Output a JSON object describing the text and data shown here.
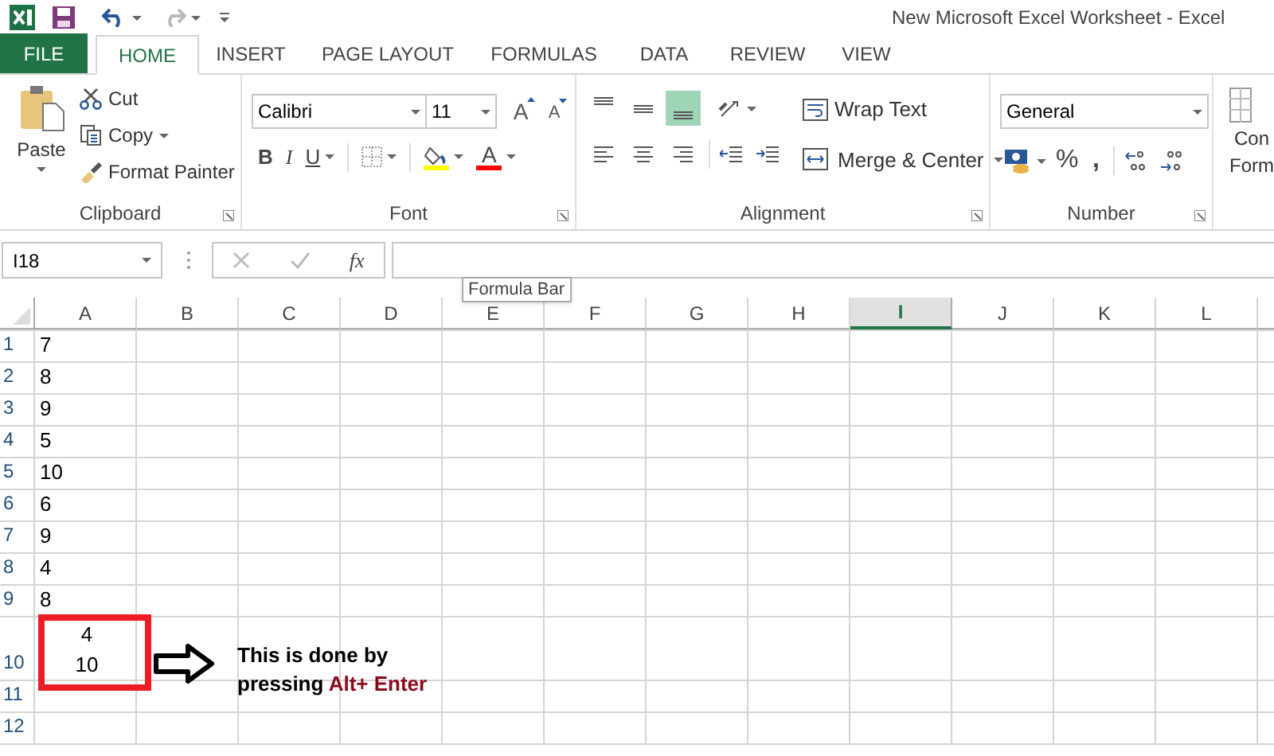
{
  "window": {
    "title": "New Microsoft Excel Worksheet - Excel"
  },
  "tabs": [
    {
      "label": "FILE",
      "kind": "file",
      "selected": false
    },
    {
      "label": "HOME",
      "kind": "tab",
      "selected": true
    },
    {
      "label": "INSERT",
      "kind": "tab",
      "selected": false
    },
    {
      "label": "PAGE LAYOUT",
      "kind": "tab",
      "selected": false
    },
    {
      "label": "FORMULAS",
      "kind": "tab",
      "selected": false
    },
    {
      "label": "DATA",
      "kind": "tab",
      "selected": false
    },
    {
      "label": "REVIEW",
      "kind": "tab",
      "selected": false
    },
    {
      "label": "VIEW",
      "kind": "tab",
      "selected": false
    }
  ],
  "clipboard": {
    "paste": "Paste",
    "cut": "Cut",
    "copy": "Copy",
    "format_painter": "Format Painter",
    "label": "Clipboard"
  },
  "font": {
    "name": "Calibri",
    "size": "11",
    "grow": "A",
    "shrink": "A",
    "bold": "B",
    "italic": "I",
    "underline": "U",
    "color_button": "A",
    "label": "Font"
  },
  "alignment": {
    "vertical": [
      {
        "selected": false
      },
      {
        "selected": false
      },
      {
        "selected": true
      }
    ],
    "wrap_text": "Wrap Text",
    "merge_center": "Merge & Center",
    "label": "Alignment"
  },
  "number": {
    "format": "General",
    "percent": "%",
    "comma": ",",
    "label": "Number"
  },
  "styles": {
    "lines": [
      "Con",
      "Form"
    ]
  },
  "formula_bar": {
    "name_box": "I18",
    "function": "fx",
    "tooltip": "Formula Bar"
  },
  "grid": {
    "columns": [
      {
        "label": "A",
        "selected": false
      },
      {
        "label": "B",
        "selected": false
      },
      {
        "label": "C",
        "selected": false
      },
      {
        "label": "D",
        "selected": false
      },
      {
        "label": "E",
        "selected": false
      },
      {
        "label": "F",
        "selected": false
      },
      {
        "label": "G",
        "selected": false
      },
      {
        "label": "H",
        "selected": false
      },
      {
        "label": "I",
        "selected": true
      },
      {
        "label": "J",
        "selected": false
      },
      {
        "label": "K",
        "selected": false
      },
      {
        "label": "L",
        "selected": false
      }
    ],
    "rows": [
      {
        "header": "1",
        "a": "7"
      },
      {
        "header": "2",
        "a": "8"
      },
      {
        "header": "3",
        "a": "9"
      },
      {
        "header": "4",
        "a": "5"
      },
      {
        "header": "5",
        "a": "10"
      },
      {
        "header": "6",
        "a": "6"
      },
      {
        "header": "7",
        "a": "9"
      },
      {
        "header": "8",
        "a": "4"
      },
      {
        "header": "9",
        "a": "8"
      },
      {
        "header": "10",
        "a": "4\n10",
        "kind": "tall"
      },
      {
        "header": "11"
      },
      {
        "header": "12"
      }
    ]
  },
  "note": {
    "lines": [
      "This is done by",
      "pressing "
    ],
    "keys": "Alt+ Enter"
  }
}
